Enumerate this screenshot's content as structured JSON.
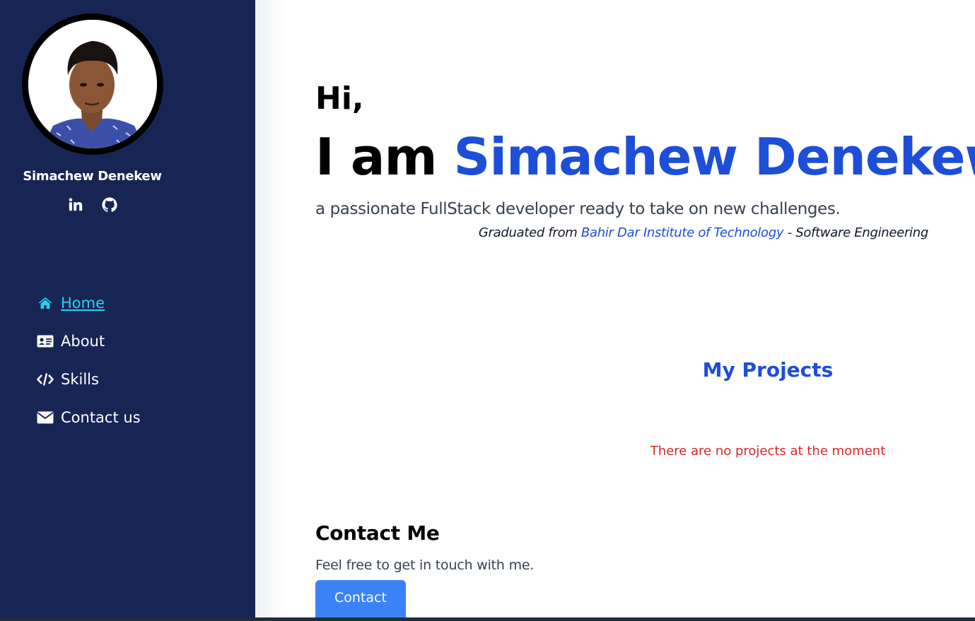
{
  "profile": {
    "name": "Simachew Denekew",
    "social": [
      {
        "icon": "linkedin-icon",
        "label": "LinkedIn"
      },
      {
        "icon": "github-icon",
        "label": "GitHub"
      }
    ]
  },
  "nav": {
    "items": [
      {
        "label": "Home",
        "icon": "home-icon",
        "active": true
      },
      {
        "label": "About",
        "icon": "id-card-icon",
        "active": false
      },
      {
        "label": "Skills",
        "icon": "code-icon",
        "active": false
      },
      {
        "label": "Contact us",
        "icon": "envelope-icon",
        "active": false
      }
    ]
  },
  "hero": {
    "greeting": "Hi,",
    "intro": "I am ",
    "name": "Simachew Denekew",
    "tagline": "a passionate FullStack developer ready to take on new challenges.",
    "education_prefix": "Graduated from ",
    "school": "Bahir Dar Institute of Technology",
    "education_suffix": " - Software Engineering"
  },
  "projects": {
    "title": "My Projects",
    "empty_message": "There are no projects at the moment"
  },
  "contact": {
    "title": "Contact Me",
    "text": "Feel free to get in touch with me.",
    "button_label": "Contact"
  },
  "colors": {
    "sidebar_bg": "#172554",
    "accent_blue": "#1d4ed8",
    "active_nav": "#22d3ee",
    "button_bg": "#3b82f6",
    "error_red": "#dc2626"
  }
}
